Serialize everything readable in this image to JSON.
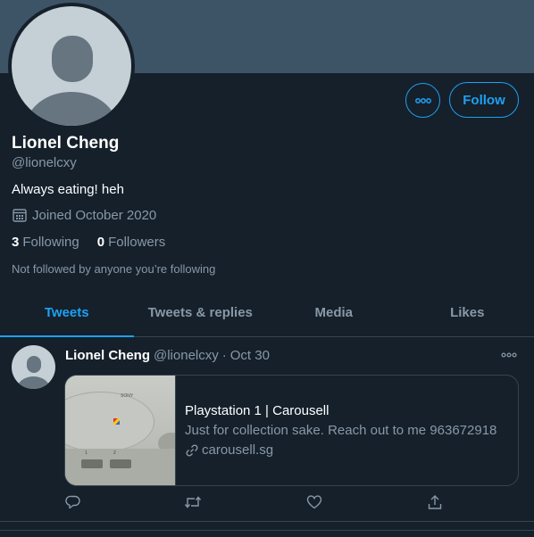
{
  "profile": {
    "name": "Lionel Cheng",
    "handle": "@lionelcxy",
    "bio": "Always eating! heh",
    "joined": "Joined October 2020",
    "following_count": "3",
    "following_label": "Following",
    "followers_count": "0",
    "followers_label": "Followers",
    "not_followed_note": "Not followed by anyone you’re following",
    "follow_button": "Follow"
  },
  "tabs": [
    {
      "label": "Tweets",
      "active": true
    },
    {
      "label": "Tweets & replies",
      "active": false
    },
    {
      "label": "Media",
      "active": false
    },
    {
      "label": "Likes",
      "active": false
    }
  ],
  "tweet": {
    "author_name": "Lionel Cheng",
    "author_handle": "@lionelcxy",
    "separator": "·",
    "date": "Oct 30",
    "card": {
      "image_brand": "SONY",
      "image_slot_1": "1",
      "image_slot_2": "2",
      "title": "Playstation 1 | Carousell",
      "description": "Just for collection sake. Reach out to me 963672918",
      "link": "carousell.sg"
    }
  },
  "icons": {
    "more": "more-icon",
    "calendar": "calendar-icon",
    "link": "link-icon",
    "reply": "reply-icon",
    "retweet": "retweet-icon",
    "like": "heart-icon",
    "share": "share-icon"
  },
  "colors": {
    "background": "#15202b",
    "banner": "#3d5466",
    "accent": "#1da1f2",
    "secondary_text": "#8899a6",
    "border": "#38444d"
  }
}
